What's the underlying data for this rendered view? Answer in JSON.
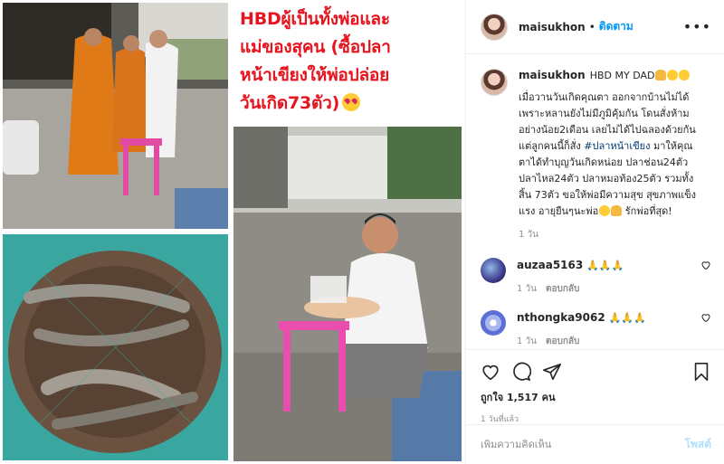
{
  "media": {
    "overlay_text": "HBDผู้เป็นทั้งพ่อและ\nแม่ของสุคน (ซื้อปลา\nหน้าเขียงให้พ่อปล่อย\nวันเกิด73ตัว)",
    "photos": [
      "monks-alms-photo",
      "fish-in-net-photo",
      "father-with-offerings-photo"
    ]
  },
  "header": {
    "username": "maisukhon",
    "separator": "•",
    "follow_label": "ติดตาม",
    "more_label": "•••"
  },
  "caption": {
    "username": "maisukhon",
    "title": "HBD MY DAD",
    "text_1": "เมื่อวานวันเกิดคุณตา ออกจากบ้านไม่ได้\nเพราะหลานยังไม่มีภูมิคุ้มกัน โดนสั่งห้าม\nอย่างน้อย2เดือน เลยไม่ได้ไปฉลองด้วยกัน\nแต่ลูกคนนี้ก็สั่ง ",
    "hashtag": "#ปลาหน้าเขียง",
    "text_2": " มาให้คุณ\nตาได้ทำบุญวันเกิดหน่อย ปลาช่อน24ตัว\nปลาไหล24ตัว ปลาหมอท้อง25ตัว รวมทั้ง\nสิ้น 73ตัว ขอให้พ่อมีความสุข สุขภาพแข็ง\nแรง อายุยืนๆนะพ่อ",
    "text_3": " รักพ่อที่สุด!",
    "time": "1 วัน"
  },
  "comments": [
    {
      "username": "auzaa5163",
      "text": "🙏🙏🙏",
      "time": "1 วัน",
      "reply_label": "ตอบกลับ"
    },
    {
      "username": "nthongka9062",
      "text": "🙏🙏🙏",
      "time": "1 วัน",
      "reply_label": "ตอบกลับ"
    }
  ],
  "actions": {
    "likes_text": "ถูกใจ 1,517 คน",
    "posted_ago": "1 วันที่แล้ว"
  },
  "add_comment": {
    "placeholder": "เพิ่มความคิดเห็น",
    "post_label": "โพสต์"
  },
  "colors": {
    "link_blue": "#0095f6",
    "overlay_red": "#e6141e",
    "post_disabled": "#b2dffc"
  }
}
